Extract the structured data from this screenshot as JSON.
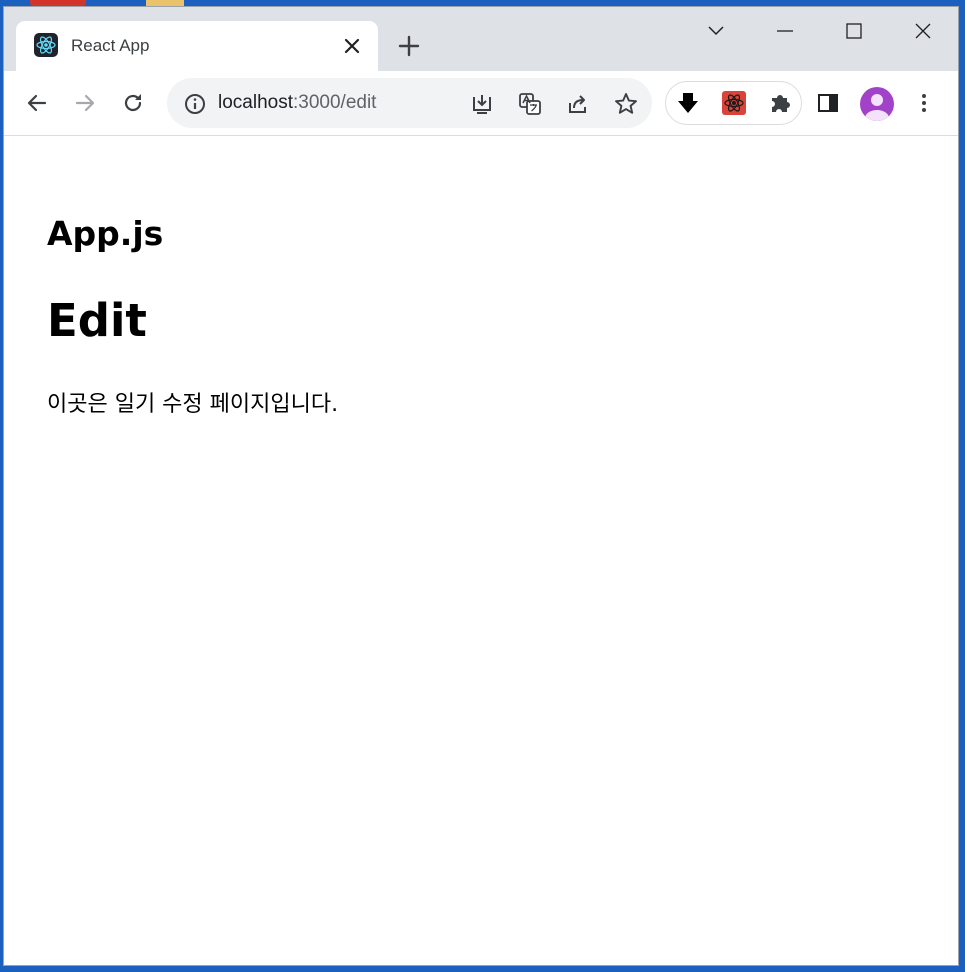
{
  "browser": {
    "tab": {
      "title": "React App"
    },
    "address_bar": {
      "host": "localhost",
      "path": ":3000/edit"
    }
  },
  "page": {
    "app_heading": "App.js",
    "page_heading": "Edit",
    "description": "이곳은 일기 수정 페이지입니다."
  },
  "colors": {
    "titlebar": "#dee1e6",
    "omnibox": "#f1f3f4",
    "avatar": "#a142c9",
    "react_icon": "#61dafb"
  }
}
